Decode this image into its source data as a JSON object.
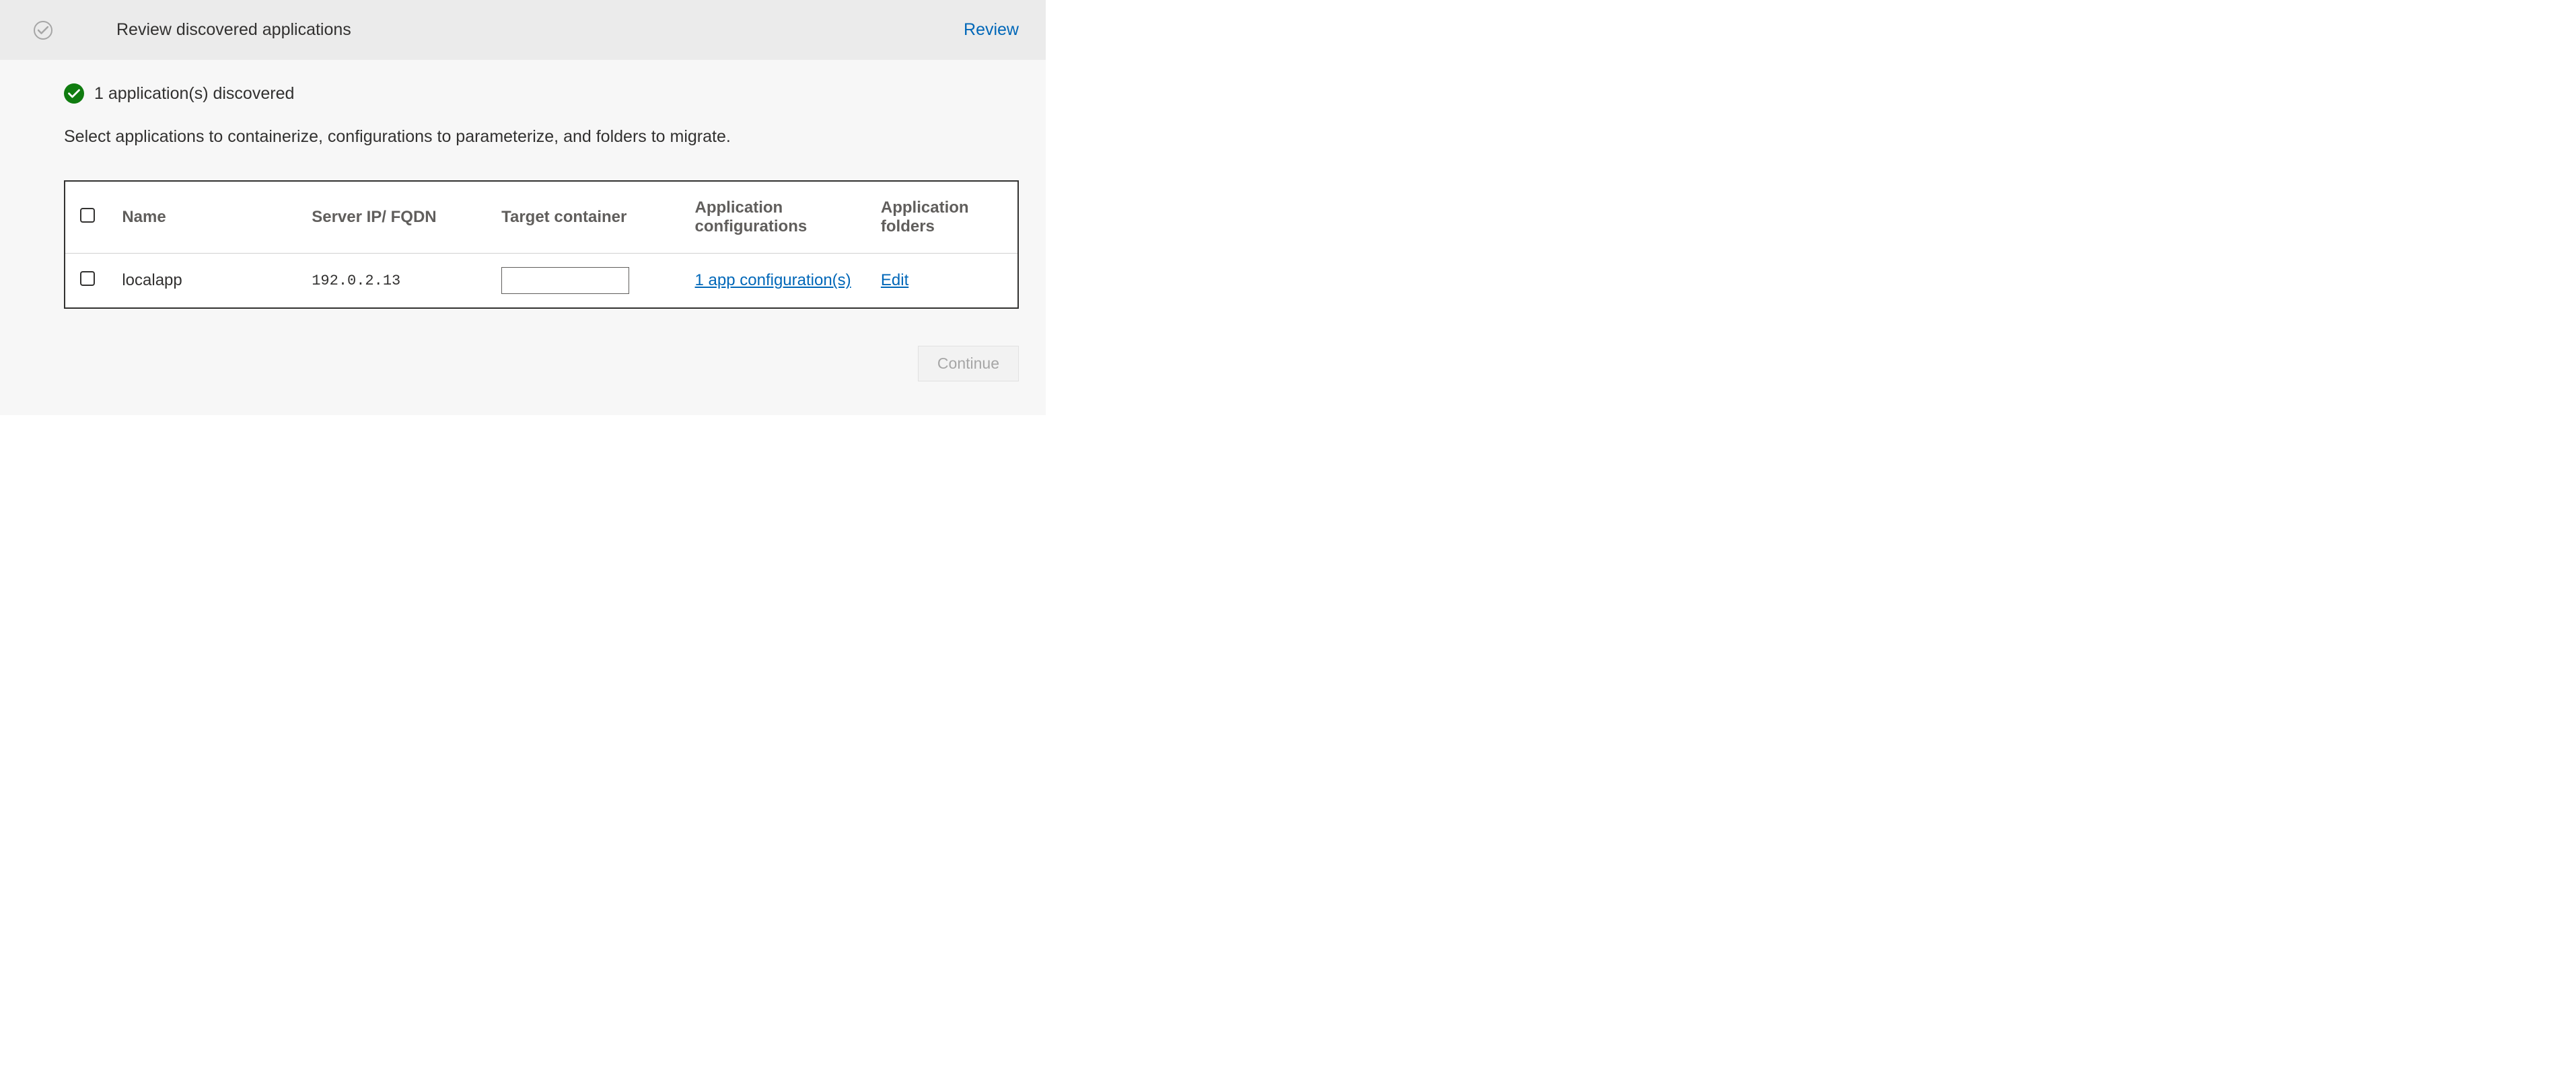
{
  "header": {
    "title": "Review discovered applications",
    "link": "Review"
  },
  "status": {
    "text": "1 application(s) discovered"
  },
  "description": "Select applications to containerize, configurations to parameterize, and folders to migrate.",
  "table": {
    "columns": {
      "name": "Name",
      "server": "Server IP/ FQDN",
      "target": "Target container",
      "config": "Application configurations",
      "folders": "Application folders"
    },
    "rows": [
      {
        "name": "localapp",
        "server": "192.0.2.13",
        "target": "",
        "config_link": "1 app configuration(s)",
        "folders_link": "Edit"
      }
    ]
  },
  "footer": {
    "continue_label": "Continue"
  }
}
